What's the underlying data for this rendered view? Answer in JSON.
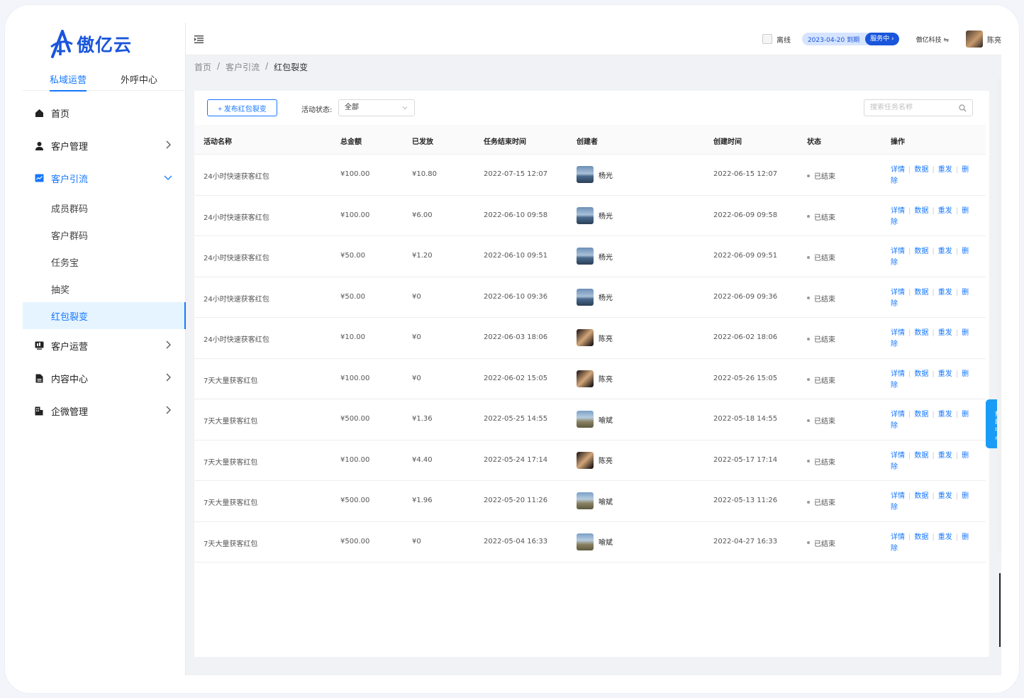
{
  "brand": {
    "name": "傲亿云",
    "color": "#1a56db"
  },
  "top_tabs": [
    {
      "label": "私域运营",
      "active": true
    },
    {
      "label": "外呼中心",
      "active": false
    }
  ],
  "menu": {
    "home": {
      "label": "首页",
      "icon": "home-icon"
    },
    "customer_mgmt": {
      "label": "客户管理",
      "icon": "user-icon"
    },
    "customer_lead": {
      "label": "客户引流",
      "icon": "chart-icon",
      "children": [
        "成员群码",
        "客户群码",
        "任务宝",
        "抽奖",
        "红包裂变"
      ],
      "active_child": "红包裂变"
    },
    "customer_ops": {
      "label": "客户运营",
      "icon": "monitor-icon"
    },
    "content_center": {
      "label": "内容中心",
      "icon": "document-icon"
    },
    "wecom_mgmt": {
      "label": "企微管理",
      "icon": "building-icon"
    }
  },
  "header": {
    "offline": "离线",
    "expire_date": "2023-04-20 到期",
    "service": "服务中 ›",
    "company": "傲亿科技 ⇋",
    "user": "陈亮"
  },
  "breadcrumb": [
    "首页",
    "/",
    "客户引流",
    "/",
    "红包裂变"
  ],
  "toolbar": {
    "publish_label": "+ 发布红包裂变",
    "status_label": "活动状态:",
    "status_value": "全部",
    "search_placeholder": "搜索任务名称"
  },
  "table": {
    "columns": [
      "活动名称",
      "总金额",
      "已发放",
      "任务结束时间",
      "创建者",
      "创建时间",
      "状态",
      "操作"
    ],
    "ops": [
      "详情",
      "数据",
      "重发",
      "删",
      "除"
    ],
    "rows": [
      {
        "name": "24小时快速获客红包",
        "total": "¥100.00",
        "sent": "¥10.80",
        "end": "2022-07-15 12:07",
        "creator": "杨光",
        "avatar": "yangguang",
        "created": "2022-06-15 12:07",
        "status": "已结束"
      },
      {
        "name": "24小时快速获客红包",
        "total": "¥100.00",
        "sent": "¥6.00",
        "end": "2022-06-10 09:58",
        "creator": "杨光",
        "avatar": "yangguang",
        "created": "2022-06-09 09:58",
        "status": "已结束"
      },
      {
        "name": "24小时快速获客红包",
        "total": "¥50.00",
        "sent": "¥1.20",
        "end": "2022-06-10 09:51",
        "creator": "杨光",
        "avatar": "yangguang",
        "created": "2022-06-09 09:51",
        "status": "已结束"
      },
      {
        "name": "24小时快速获客红包",
        "total": "¥50.00",
        "sent": "¥0",
        "end": "2022-06-10 09:36",
        "creator": "杨光",
        "avatar": "yangguang",
        "created": "2022-06-09 09:36",
        "status": "已结束"
      },
      {
        "name": "24小时快速获客红包",
        "total": "¥10.00",
        "sent": "¥0",
        "end": "2022-06-03 18:06",
        "creator": "陈亮",
        "avatar": "chenliang",
        "created": "2022-06-02 18:06",
        "status": "已结束"
      },
      {
        "name": "7天大量获客红包",
        "total": "¥100.00",
        "sent": "¥0",
        "end": "2022-06-02 15:05",
        "creator": "陈亮",
        "avatar": "chenliang",
        "created": "2022-05-26 15:05",
        "status": "已结束"
      },
      {
        "name": "7天大量获客红包",
        "total": "¥500.00",
        "sent": "¥1.36",
        "end": "2022-05-25 14:55",
        "creator": "喻斌",
        "avatar": "yubin",
        "created": "2022-05-18 14:55",
        "status": "已结束"
      },
      {
        "name": "7天大量获客红包",
        "total": "¥100.00",
        "sent": "¥4.40",
        "end": "2022-05-24 17:14",
        "creator": "陈亮",
        "avatar": "chenliang",
        "created": "2022-05-17 17:14",
        "status": "已结束"
      },
      {
        "name": "7天大量获客红包",
        "total": "¥500.00",
        "sent": "¥1.96",
        "end": "2022-05-20 11:26",
        "creator": "喻斌",
        "avatar": "yubin",
        "created": "2022-05-13 11:26",
        "status": "已结束"
      },
      {
        "name": "7天大量获客红包",
        "total": "¥500.00",
        "sent": "¥0",
        "end": "2022-05-04 16:33",
        "creator": "喻斌",
        "avatar": "yubin",
        "created": "2022-04-27 16:33",
        "status": "已结束"
      }
    ]
  },
  "help": "帮助中心"
}
